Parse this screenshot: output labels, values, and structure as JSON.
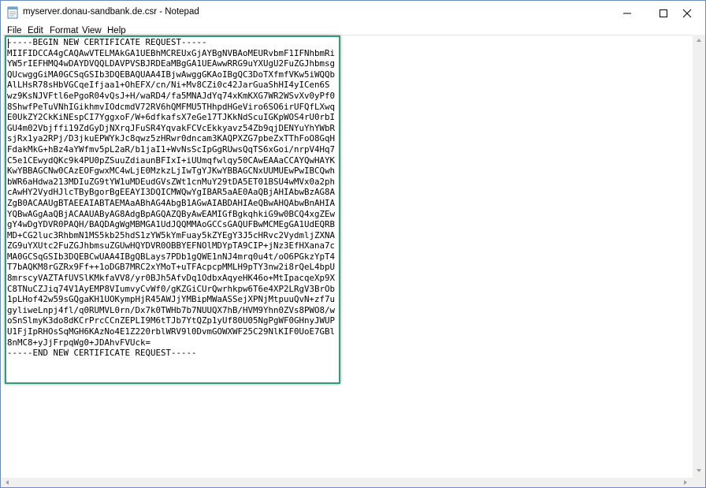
{
  "window": {
    "title": "myserver.donau-sandbank.de.csr - Notepad",
    "app_icon": "notepad-icon"
  },
  "controls": {
    "minimize_icon": "minimize-icon",
    "maximize_icon": "maximize-icon",
    "close_icon": "close-icon"
  },
  "menu": {
    "items": [
      "File",
      "Edit",
      "Format",
      "View",
      "Help"
    ]
  },
  "editor": {
    "lines": [
      "-----BEGIN NEW CERTIFICATE REQUEST-----",
      "MIIFIDCCA4gCAQAwVTELMAkGA1UEBhMCREUxGjAYBgNVBAoMEURvbmF1IFNhbmRi",
      "YW5rIEFHMQ4wDAYDVQQLDAVPVSBJRDEaMBgGA1UEAwwRRG9uYXUgU2FuZGJhbmsg",
      "QUcwggGiMA0GCSqGSIb3DQEBAQUAA4IBjwAwggGKAoIBgQC3DoTXfmfVKw5iWQQb",
      "AlLHsR78sHbVGCqeIfjaa1+OhEFX/cn/Ni+Mv8CZi0c42JarGuaShHI4yICen6S",
      "wz9KsNJVFtl6ePgoR04vQsJ+H/waRD4/fa5MNAJdYq74xKmKXG7WR2WSvXv0yPf0",
      "8ShwfPeTuVNhIGikhmvIOdcmdV72RV6hQMFMU5THhpdHGeViro6SO6irUFQfLXwq",
      "E0UkZY2CkKiNEspCI7YggxoF/W+6dfkafsX7eGe17TJKkNdScuIGKpWOS4rU0rbI",
      "GU4m02Vbjffi19ZdGyDjNXrqJFuSR4YqvakFCVcEkkyavz54Zb9qjDENYuYhYWbR",
      "sjRx1ya2RPj/D3jkuEPWYkJc8qwz5zHRwr0dncam3KAQPXZG7pbeZxTThFoO8GqH",
      "FdakMkG+hBz4aYWfmv5pL2aR/b1jaI1+WvNsScIpGgRUwsQqTS6xGoi/nrpV4Hq7",
      "C5e1CEwydQKc9k4PU0pZSuuZdiaunBFIxI+iUUmqfwlqy50CAwEAAaCCAYQwHAYK",
      "KwYBBAGCNw0CAzEOFgwxMC4wLjE0MzkzLjIwTgYJKwYBBAGCNxUUMUEwPwIBCQwh",
      "bWR6aHdwa213MDIuZG9tYW1uMDEudGVsZWt1cnMuY29tDA5ET01BSU4wMVx0a2ph",
      "cAwHY2VydHJlcTByBgorBgEEAYI3DQICMWQwYgIBAR5aAE0AaQBjAHIAbwBzAG8A",
      "ZgB0ACAAUgBTAEEAIABTAEMAaABhAG4AbgB1AGwAIABDAHIAeQBwAHQAbwBnAHIA",
      "YQBwAGgAaQBjACAAUAByAG8AdgBpAGQAZQByAwEAMIGfBgkqhkiG9w0BCQ4xgZEw",
      "gY4wDgYDVR0PAQH/BAQDAgWgMBMGA1UdJQQMMAoGCCsGAQUFBwMCMEgGA1UdEQRB",
      "MD+CG2luc3RhbmN1MS5kb25hdS1zYW5kYmFuay5kZYEgY3J5cHRvc2VydmljZXNA",
      "ZG9uYXUtc2FuZGJhbmsuZGUwHQYDVR0OBBYEFNOlMDYpTA9CIP+jNz3EfHXana7c",
      "MA0GCSqGSIb3DQEBCwUAA4IBgQBLays7PDb1gQWE1nNJ4mrq0u4t/oO6PGkzYpT4",
      "T7bAQKM8rGZRx9Ff++1oDGB7MRC2xYMoT+uTFAcpcpMMLH9pTY3nw2i8rQeL4bpU",
      "8mrscyVAZTAfUVSlKMkfaVV8/yr0BJh5AfvDq1OdbxAqyeHK46o+MtIpacqeXp9X",
      "C8TNuCZJiq74V1AyEMP8VIumvyCvWf0/gKZGiCUrQwrhkpw6T6e4XP2LRgV3BrOb",
      "1pLHof42w59sGQgaKH1UOKympHjR45AWJjYMBipMWaASSejXPNjMtpuuQvN+zf7u",
      "gyliweLnpj4fl/q0RUMVL0rn/Dx7k0TWHb7b7NUUQX7hB/HVM9Yhn0ZVs8PWO8/w",
      "oSnSlmyK3do8dKCrPrcCCnZEPLI9M6tTJb7YtQZp1yUf80U05NgPgWF0GHnyJWUP",
      "U1FjIpRHOsSqMGH6KAzNo4E1Z220rblWRV9l0DvmGOWXWF25C29NlKIF0UoE7GBl",
      "8nMC8+yJjFrpqWg0+JDAhvFVUck=",
      "-----END NEW CERTIFICATE REQUEST-----"
    ]
  },
  "scrollbars": {
    "up_icon": "scroll-up-arrow-icon",
    "down_icon": "scroll-down-arrow-icon",
    "left_icon": "scroll-left-arrow-icon",
    "right_icon": "scroll-right-arrow-icon"
  },
  "colors": {
    "highlight_border": "#2e9e7a",
    "window_border": "#6b8db5"
  }
}
